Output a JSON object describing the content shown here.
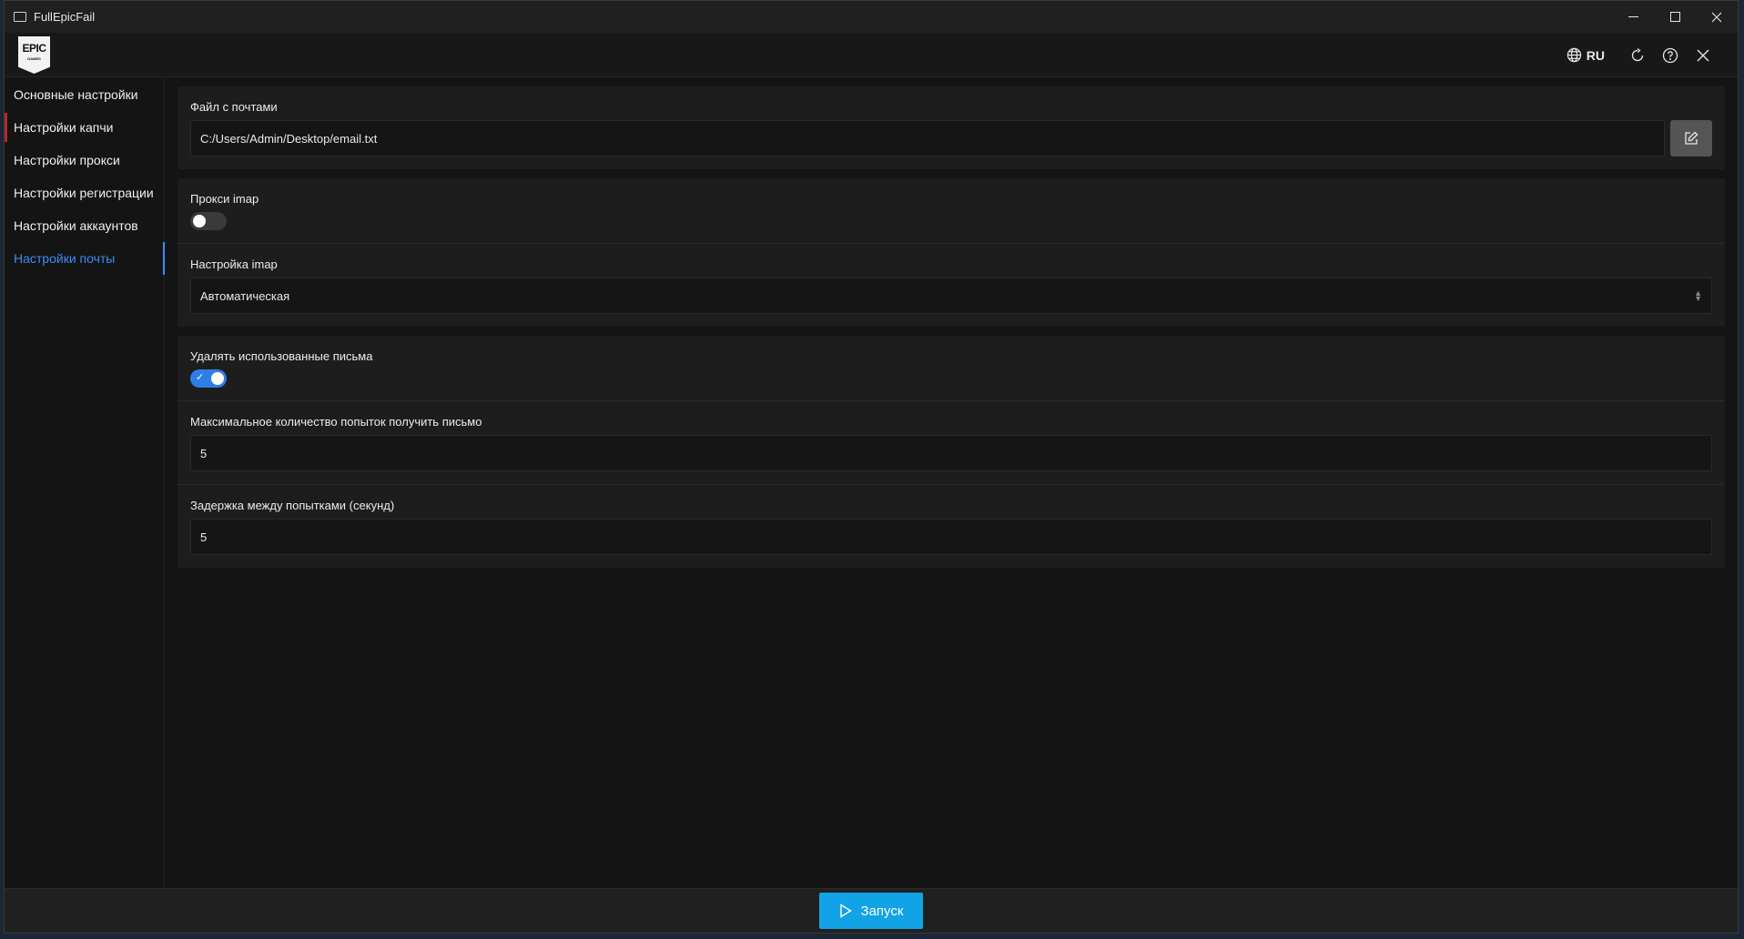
{
  "window": {
    "title": "FullEpicFail"
  },
  "header": {
    "logo": {
      "line1": "EPIC",
      "line2": "GAMES"
    },
    "language": "RU",
    "icons": [
      "globe-icon",
      "refresh-icon",
      "help-icon",
      "close-icon"
    ]
  },
  "sidebar": {
    "items": [
      {
        "label": "Основные настройки"
      },
      {
        "label": "Настройки капчи"
      },
      {
        "label": "Настройки прокси"
      },
      {
        "label": "Настройки регистрации"
      },
      {
        "label": "Настройки аккаунтов"
      },
      {
        "label": "Настройки почты"
      }
    ],
    "active_index": 5
  },
  "mail_file": {
    "label": "Файл с почтами",
    "value": "C:/Users/Admin/Desktop/email.txt"
  },
  "imap_proxy": {
    "label": "Прокси imap",
    "enabled": false
  },
  "imap_setting": {
    "label": "Настройка imap",
    "selected": "Автоматическая"
  },
  "delete_used": {
    "label": "Удалять использованные письма",
    "enabled": true
  },
  "max_attempts": {
    "label": "Максимальное количество попыток получить письмо",
    "value": "5"
  },
  "delay": {
    "label": "Задержка между попытками (секунд)",
    "value": "5"
  },
  "footer": {
    "run_label": "Запуск"
  },
  "colors": {
    "accent": "#3d8df5",
    "run_button": "#12a3e6",
    "toggle_on": "#2f7ee6"
  }
}
